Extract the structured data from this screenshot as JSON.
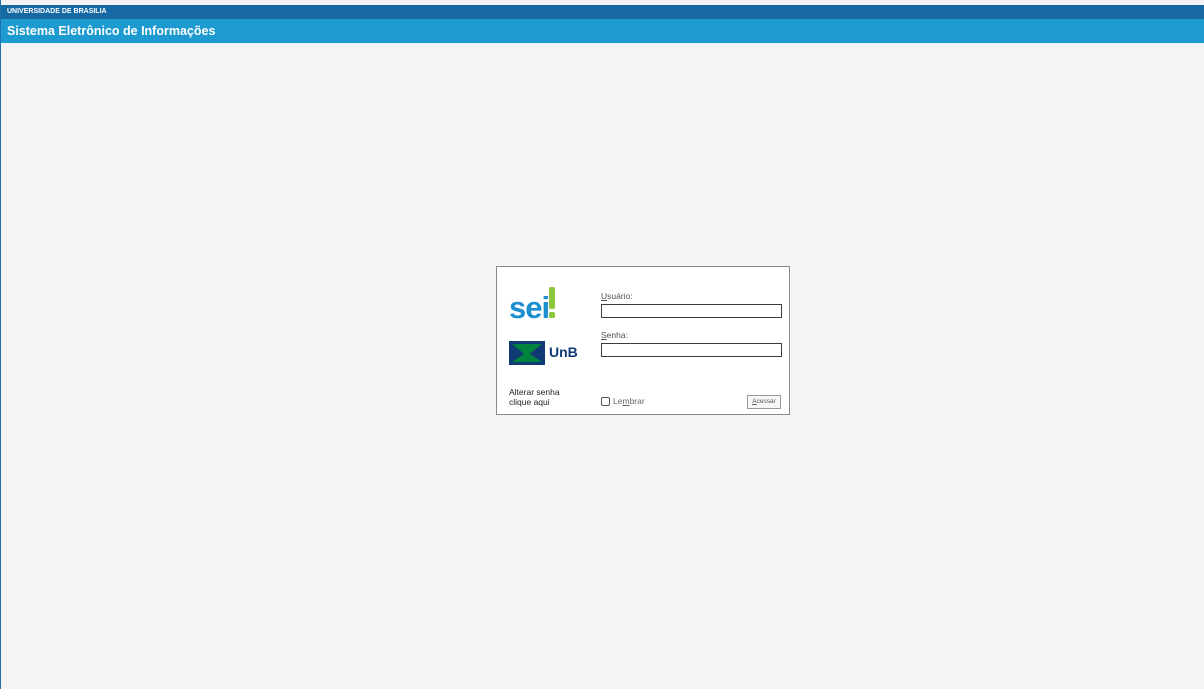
{
  "header": {
    "institution": "UNIVERSIDADE DE BRASILIA",
    "system_title": "Sistema Eletrônico de Informações"
  },
  "login": {
    "logo_sei_text": "sei",
    "logo_unb_text": "UnB",
    "username_label_access_key": "U",
    "username_label_rest": "suário:",
    "username_value": "",
    "password_label_access_key": "S",
    "password_label_rest": "enha:",
    "password_value": "",
    "change_password_line1": "Alterar senha",
    "change_password_line2": "clique aqui",
    "remember_label_pre": "Le",
    "remember_label_key": "m",
    "remember_label_post": "brar",
    "remember_checked": false,
    "access_button_key": "A",
    "access_button_rest": "cessar"
  },
  "colors": {
    "header_strip": "#1669a3",
    "header_bar": "#1d9ad0",
    "page_background": "#f4f4f4",
    "sei_blue": "#1b8fcf",
    "sei_green": "#8dc63f",
    "unb_blue": "#0f3a73",
    "unb_green": "#00843d"
  }
}
